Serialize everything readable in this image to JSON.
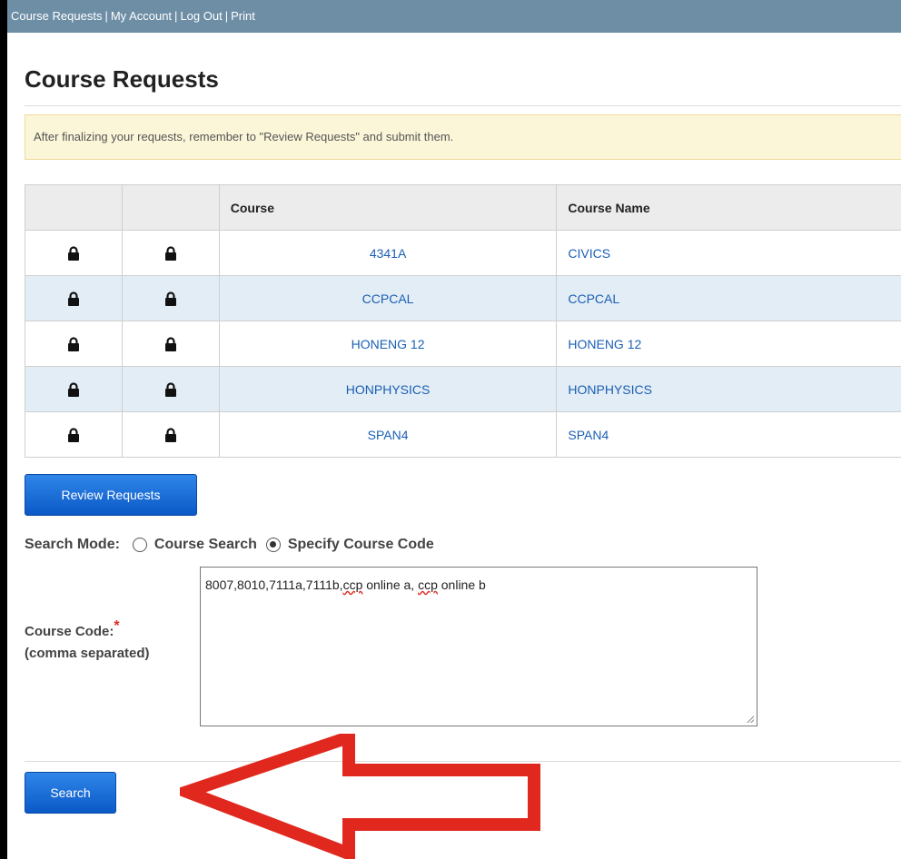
{
  "topbar": {
    "links": [
      "Course Requests",
      "My Account",
      "Log Out",
      "Print"
    ],
    "separator": "|"
  },
  "page_title": "Course Requests",
  "notice": "After finalizing your requests, remember to \"Review Requests\" and submit them.",
  "table": {
    "headers": [
      "",
      "",
      "Course",
      "Course Name"
    ],
    "rows": [
      {
        "code": "4341A",
        "name": "CIVICS"
      },
      {
        "code": "CCPCAL",
        "name": "CCPCAL"
      },
      {
        "code": "HONENG 12",
        "name": "HONENG 12"
      },
      {
        "code": "HONPHYSICS",
        "name": "HONPHYSICS"
      },
      {
        "code": "SPAN4",
        "name": "SPAN4"
      }
    ],
    "row_icon": "lock-icon"
  },
  "review_button": "Review Requests",
  "search_mode": {
    "label": "Search Mode:",
    "options": [
      "Course Search",
      "Specify Course Code"
    ],
    "selected": "Specify Course Code"
  },
  "course_code": {
    "label": "Course Code:",
    "required_mark": "*",
    "hint": "(comma separated)",
    "value_parts": [
      "8007,8010,7111a,7111b,",
      "ccp",
      " online a, ",
      "ccp",
      " online b"
    ]
  },
  "search_button": "Search",
  "annotation": {
    "icon": "red-arrow-icon",
    "color": "#e0281e"
  },
  "colors": {
    "topbar": "#6e8ea6",
    "link": "#1a5fb4",
    "button": "#1a6fdc",
    "notice_bg": "#fcf6d9"
  }
}
